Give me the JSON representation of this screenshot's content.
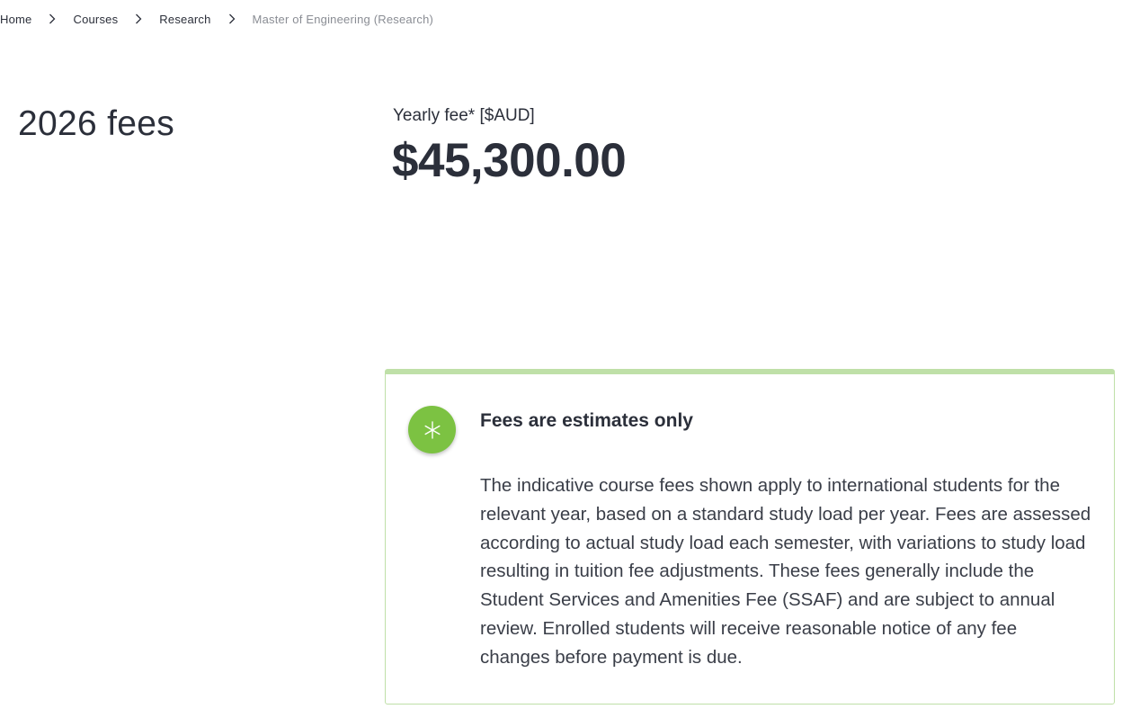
{
  "breadcrumb": {
    "items": [
      "Home",
      "Courses",
      "Research"
    ],
    "current": "Master of Engineering (Research)"
  },
  "fees": {
    "title": "2026 fees",
    "yearly_label": "Yearly fee* [$AUD]",
    "yearly_amount": "$45,300.00"
  },
  "notice": {
    "icon": "asterisk-icon",
    "heading": "Fees are estimates only",
    "body": "The indicative course fees shown apply to international students for the relevant year, based on a standard study load per year. Fees are assessed according to actual study load each semester, with variations to study load resulting in tuition fee adjustments. These fees generally include the Student Services and Amenities Fee (SSAF) and are subject to annual review. Enrolled students will receive reasonable notice of any fee changes before payment is due."
  },
  "colors": {
    "text": "#2b2f3a",
    "muted": "#8a8d94",
    "accent_green": "#7cc242",
    "card_border": "#bfe0a8"
  }
}
